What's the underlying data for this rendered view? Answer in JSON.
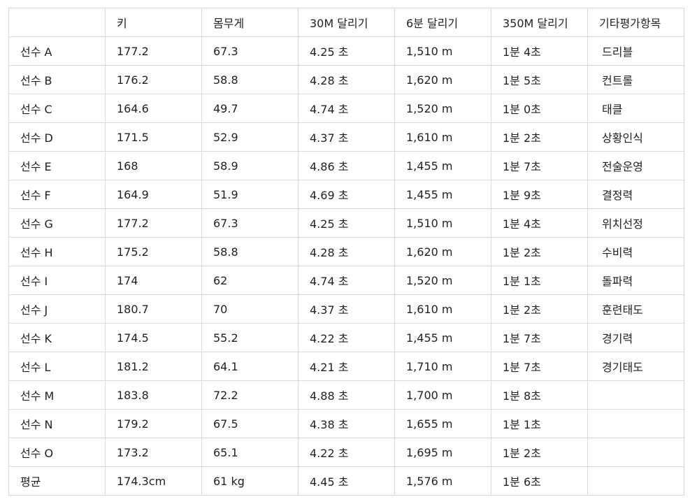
{
  "table": {
    "headers": [
      "",
      "키",
      "몸무게",
      "30M 달리기",
      "6분 달리기",
      "350M 달리기",
      "기타평가항목"
    ],
    "rows": [
      [
        "선수 A",
        "177.2",
        "67.3",
        "4.25 초",
        "1,510 m",
        "1분 4초",
        "드리블"
      ],
      [
        "선수 B",
        "176.2",
        "58.8",
        "4.28 초",
        "1,620 m",
        "1분 5초",
        "컨트롤"
      ],
      [
        "선수 C",
        "164.6",
        "49.7",
        "4.74 초",
        "1,520 m",
        "1분 0초",
        "태클"
      ],
      [
        "선수 D",
        "171.5",
        "52.9",
        "4.37 초",
        "1,610 m",
        "1분 2초",
        "상황인식"
      ],
      [
        "선수 E",
        "168",
        "58.9",
        "4.86 초",
        "1,455 m",
        "1분 7초",
        "전술운영"
      ],
      [
        "선수 F",
        "164.9",
        "51.9",
        "4.69 초",
        "1,455 m",
        "1분 9초",
        "결정력"
      ],
      [
        "선수 G",
        "177.2",
        "67.3",
        "4.25 초",
        "1,510 m",
        "1분 4초",
        "위치선정"
      ],
      [
        "선수 H",
        "175.2",
        "58.8",
        "4.28 초",
        "1,620 m",
        "1분 2초",
        "수비력"
      ],
      [
        "선수 I",
        "174",
        "62",
        "4.74 초",
        "1,520 m",
        "1분 1초",
        "돌파력"
      ],
      [
        "선수 J",
        "180.7",
        "70",
        "4.37 초",
        "1,610 m",
        "1분 2초",
        "훈련태도"
      ],
      [
        "선수 K",
        "174.5",
        "55.2",
        "4.22 초",
        "1,455 m",
        "1분 7초",
        "경기력"
      ],
      [
        "선수 L",
        "181.2",
        "64.1",
        "4.21 초",
        "1,710 m",
        "1분 7초",
        "경기태도"
      ],
      [
        "선수 M",
        "183.8",
        "72.2",
        "4.88 초",
        "1,700 m",
        "1분 8초",
        ""
      ],
      [
        "선수 N",
        "179.2",
        "67.5",
        "4.38 초",
        "1,655 m",
        "1분 1초",
        ""
      ],
      [
        "선수 O",
        "173.2",
        "65.1",
        "4.22 초",
        "1,695 m",
        "1분 2초",
        ""
      ],
      [
        "평균",
        "174.3cm",
        " 61 kg",
        "4.45 초",
        "1,576 m",
        "1분 6초",
        ""
      ]
    ]
  }
}
